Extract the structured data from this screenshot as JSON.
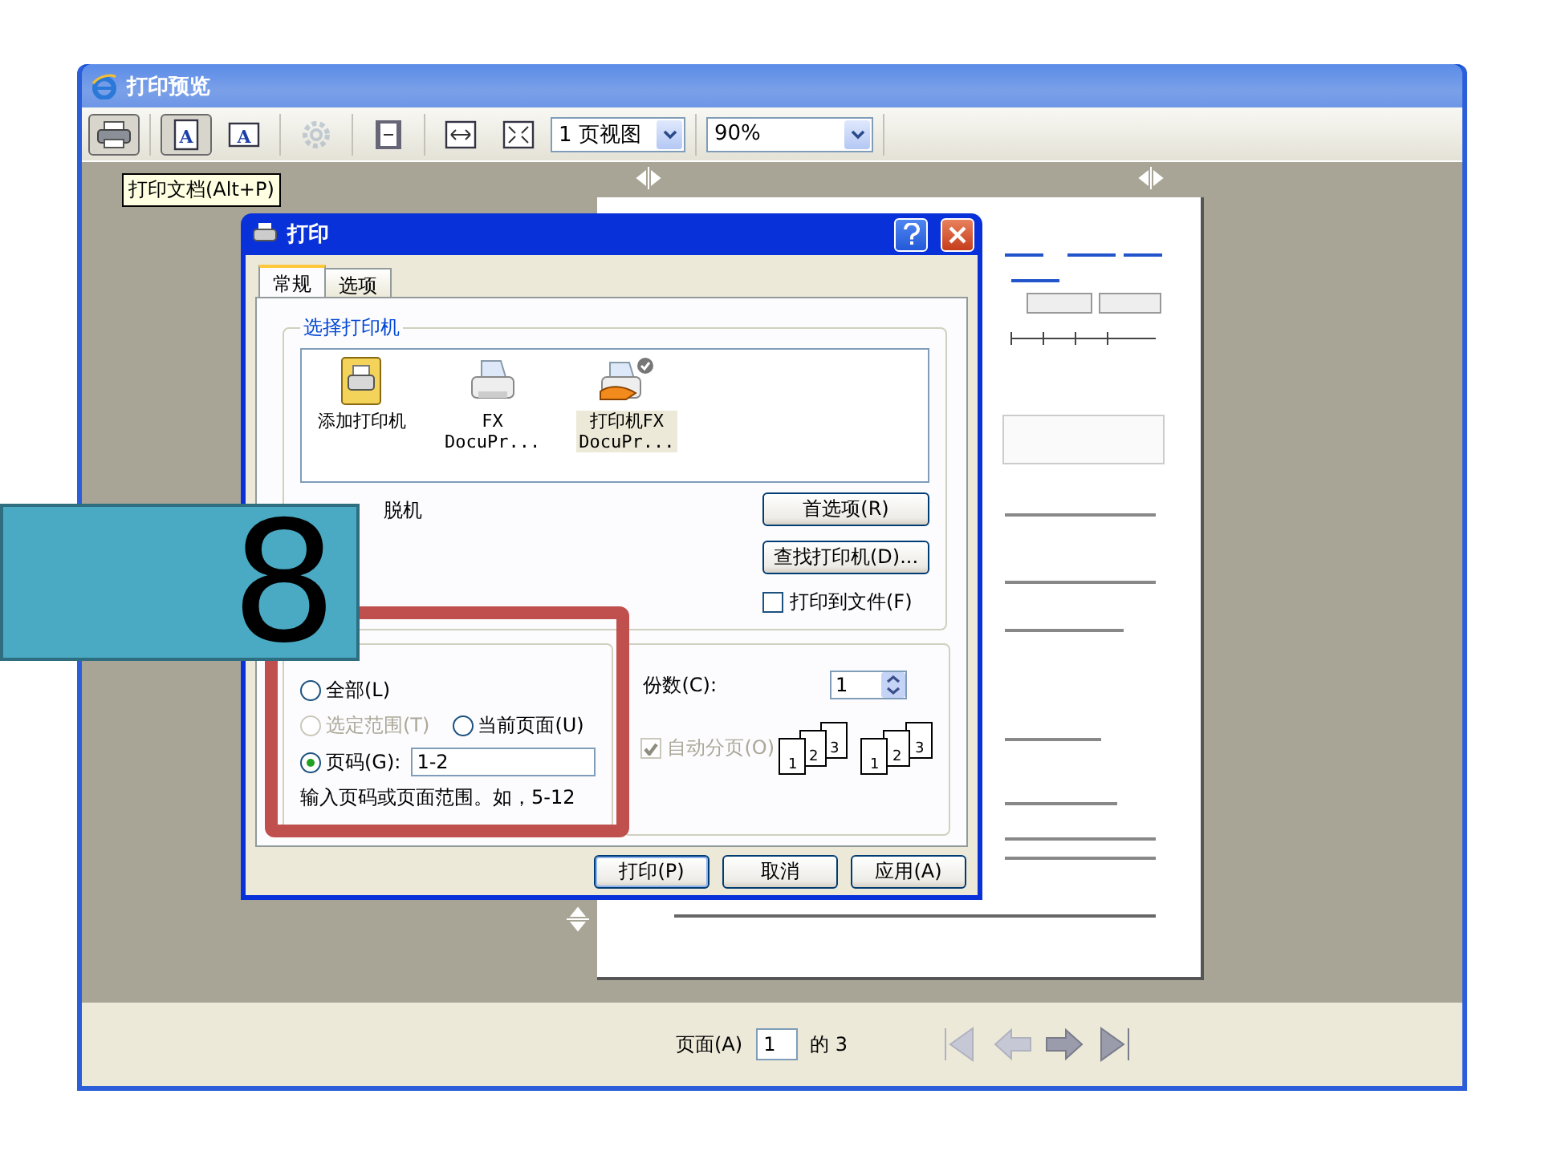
{
  "window": {
    "title": "打印预览"
  },
  "toolbar": {
    "buttons": [
      {
        "kind": "print",
        "pressed": true,
        "disabled": false
      },
      {
        "kind": "portrait",
        "pressed": true,
        "disabled": false,
        "label": "A"
      },
      {
        "kind": "landscape",
        "pressed": false,
        "disabled": false,
        "label": "A"
      },
      {
        "kind": "settings",
        "pressed": false,
        "disabled": true
      },
      {
        "kind": "page",
        "pressed": false,
        "disabled": false
      },
      {
        "kind": "fit-width",
        "pressed": false,
        "disabled": false
      },
      {
        "kind": "fit-page",
        "pressed": false,
        "disabled": false
      }
    ],
    "view_select": {
      "value": "1 页视图"
    },
    "zoom_select": {
      "value": "90%"
    }
  },
  "tooltip": "打印文档(Alt+P)",
  "dialog": {
    "title": "打印",
    "tabs": [
      {
        "label": "常规",
        "selected": true
      },
      {
        "label": "选项",
        "selected": false
      }
    ],
    "printer_group": {
      "title": "选择打印机",
      "printers": [
        {
          "kind": "add",
          "name_lines": [
            "添加打印机"
          ],
          "selected": false
        },
        {
          "kind": "printer",
          "name_lines": [
            "FX",
            "DocuPr..."
          ],
          "selected": false
        },
        {
          "kind": "default",
          "name_lines": [
            "打印机FX",
            "DocuPr..."
          ],
          "selected": true
        }
      ],
      "status_value": "脱机",
      "buttons": [
        "首选项(R)",
        "查找打印机(D)..."
      ],
      "print_to_file": {
        "label": "打印到文件(F)",
        "checked": false
      }
    },
    "range": {
      "options": [
        {
          "label": "全部(L)",
          "selected": false,
          "disabled": false
        },
        {
          "label": "选定范围(T)",
          "selected": false,
          "disabled": true
        },
        {
          "label": "当前页面(U)",
          "selected": false,
          "disabled": false
        },
        {
          "label": "页码(G):",
          "selected": true,
          "disabled": false
        }
      ],
      "pages_value": "1-2",
      "hint": "输入页码或页面范围。如，5-12"
    },
    "copies": {
      "label": "份数(C):",
      "value": "1",
      "collate_icons": [
        {
          "pages": [
            "1",
            "2",
            "3"
          ]
        },
        {
          "pages": [
            "1",
            "2",
            "3"
          ]
        }
      ],
      "collate": {
        "label": "自动分页(O)",
        "checked": true,
        "disabled": true
      }
    },
    "footer_buttons": [
      "打印(P)",
      "取消",
      "应用(A)"
    ]
  },
  "status_bar": {
    "page_label": "页面(A)",
    "page_value": "1",
    "of_text": "的 3",
    "nav": [
      {
        "kind": "first",
        "disabled": true
      },
      {
        "kind": "prev",
        "disabled": true
      },
      {
        "kind": "next",
        "disabled": false
      },
      {
        "kind": "last",
        "disabled": false
      }
    ]
  },
  "step_badge": {
    "text": "8"
  }
}
